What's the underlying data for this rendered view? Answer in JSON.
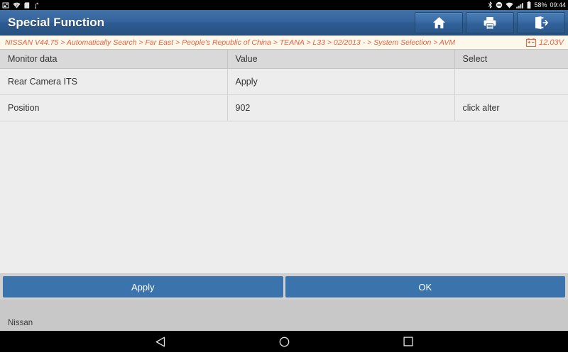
{
  "statusbar": {
    "left_icons": [
      "screenshot-icon",
      "wifi-off-icon",
      "sdcard-icon",
      "usb-icon"
    ],
    "right_icons": [
      "bluetooth-icon",
      "do-not-disturb-icon",
      "wifi-icon",
      "signal-icon",
      "battery-icon"
    ],
    "battery_percent": "58%",
    "clock": "09:44"
  },
  "titlebar": {
    "title": "Special Function",
    "buttons": [
      {
        "name": "home-button",
        "icon": "home-icon"
      },
      {
        "name": "print-button",
        "icon": "printer-icon"
      },
      {
        "name": "exit-button",
        "icon": "exit-icon"
      }
    ]
  },
  "breadcrumb": {
    "path": "NISSAN V44.75 > Automatically Search > Far East > People's Republic of China > TEANA > L33 > 02/2013 - > System Selection > AVM",
    "voltage": "12.03V",
    "voltage_icon": "car-battery-icon"
  },
  "table": {
    "columns": [
      "Monitor data",
      "Value",
      "Select"
    ],
    "rows": [
      {
        "monitor_data": "Rear Camera ITS",
        "value": "Apply",
        "select": ""
      },
      {
        "monitor_data": "Position",
        "value": "902",
        "select": "click alter"
      }
    ]
  },
  "actions": {
    "apply_label": "Apply",
    "ok_label": "OK"
  },
  "footer": {
    "vehicle": "Nissan"
  },
  "navbar": {
    "back": "back-triangle-icon",
    "home": "home-circle-icon",
    "recents": "recents-square-icon"
  },
  "colors": {
    "title_blue": "#35649d",
    "button_blue": "#3b74ad",
    "breadcrumb_orange": "#e8603c",
    "breadcrumb_bg": "#fdf8ec",
    "content_bg": "#ededed"
  }
}
